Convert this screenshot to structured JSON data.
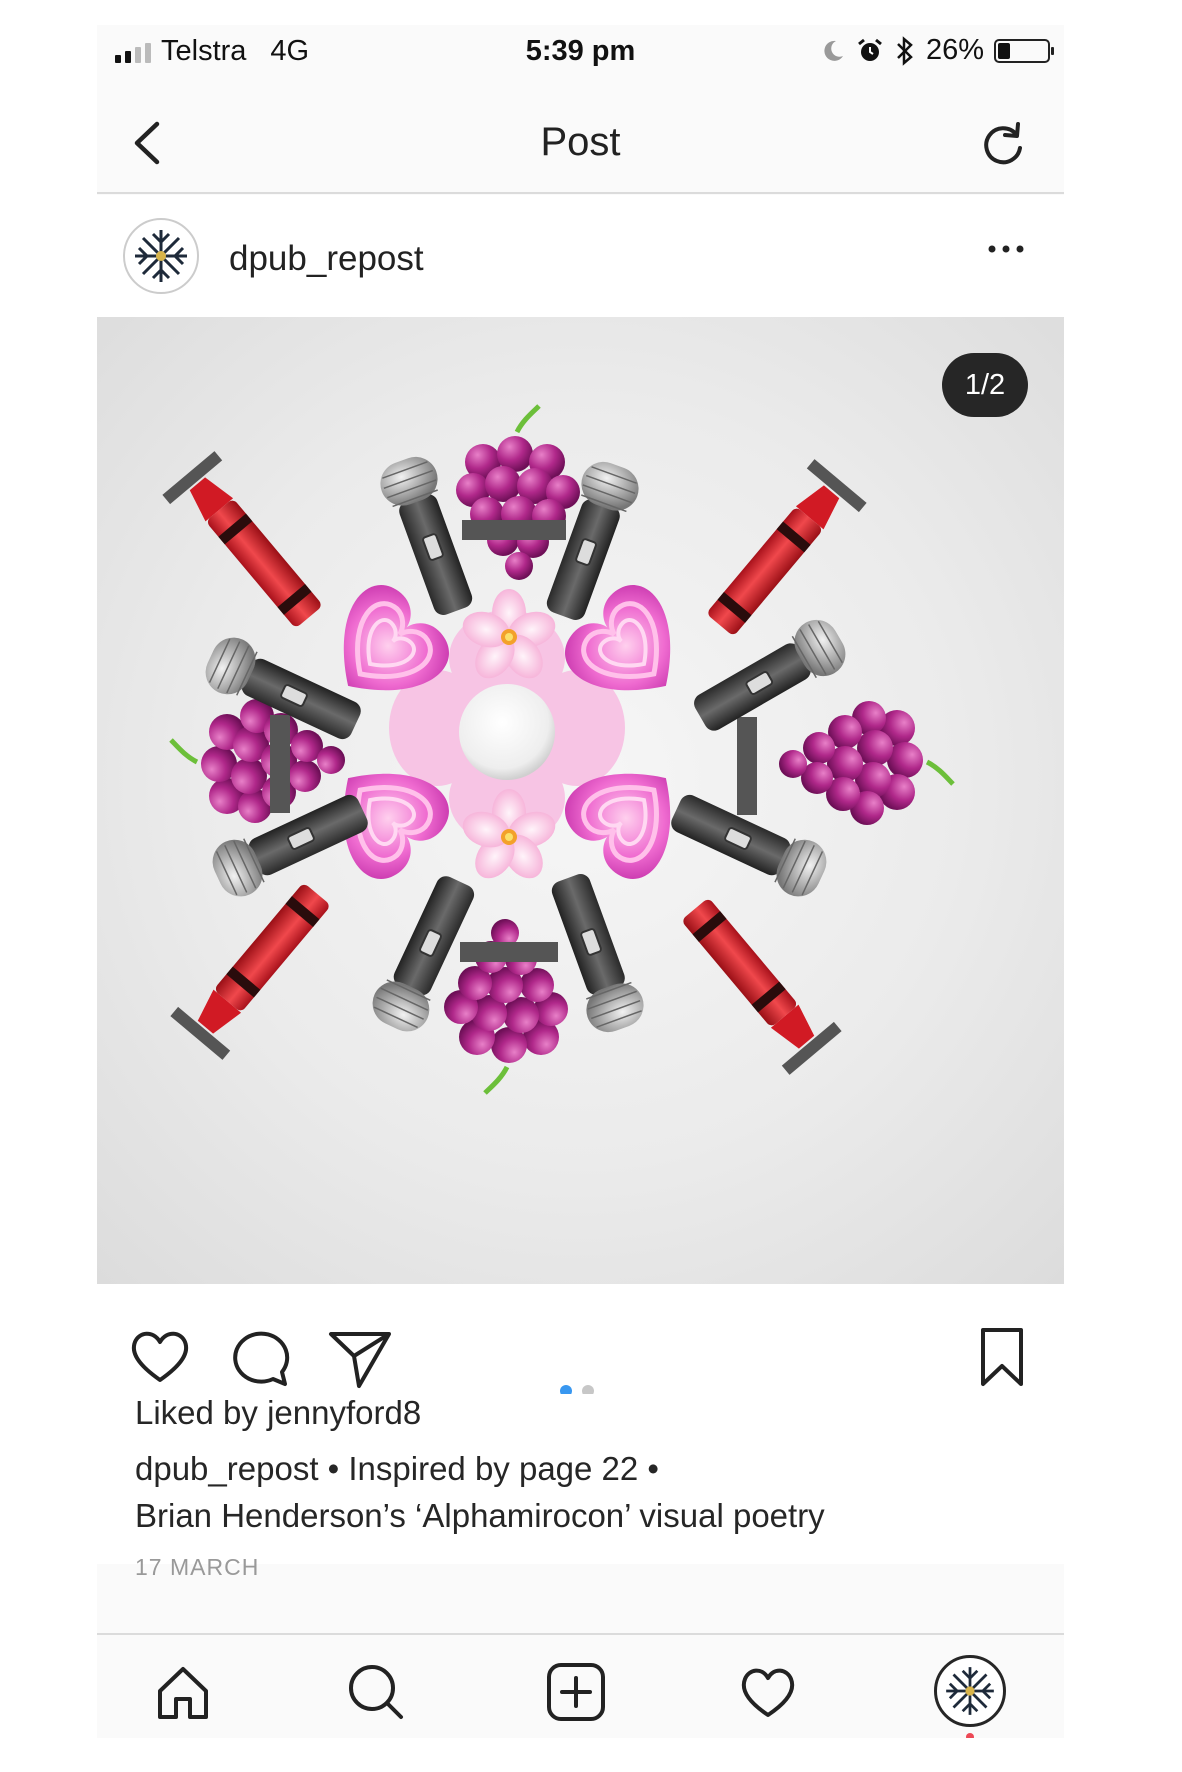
{
  "status_bar": {
    "carrier": "Telstra",
    "network": "4G",
    "time": "5:39 pm",
    "battery_percent": "26%",
    "battery_level": 0.26,
    "icons": [
      "signal-icon",
      "moon-icon",
      "alarm-icon",
      "bluetooth-icon",
      "battery-icon"
    ]
  },
  "nav": {
    "title": "Post",
    "back_icon": "chevron-left-icon",
    "refresh_icon": "refresh-icon"
  },
  "post": {
    "username": "dpub_repost",
    "image_counter": "1/2",
    "carousel_index": 1,
    "carousel_total": 2,
    "liked_by_prefix": "Liked by ",
    "liked_by_user": "jennyford8",
    "caption_user": "dpub_repost",
    "caption_line1": " • Inspired by page 22 •",
    "caption_line2": "Brian Henderson’s ‘Alphamirocon’ visual poetry",
    "date": "17 MARCH"
  },
  "actions": [
    "heart-icon",
    "comment-icon",
    "share-icon",
    "bookmark-icon"
  ],
  "tabs": [
    "home-icon",
    "search-icon",
    "add-post-icon",
    "activity-heart-icon",
    "profile-avatar"
  ],
  "colors": {
    "accent_blue": "#3897f0",
    "notification_red": "#ed4956",
    "text": "#262626",
    "muted": "#999999"
  }
}
